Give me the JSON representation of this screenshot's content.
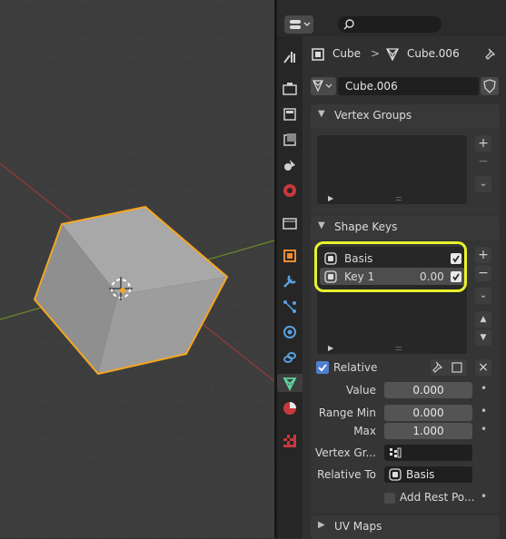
{
  "breadcrumb": {
    "object": "Cube",
    "separator": ">",
    "mesh": "Cube.006"
  },
  "mesh_name": "Cube.006",
  "panels": {
    "vertex_groups": {
      "title": "Vertex Groups",
      "add": "+",
      "remove": "−"
    },
    "shape_keys": {
      "title": "Shape Keys",
      "keys": [
        {
          "name": "Basis",
          "value": "",
          "enabled": true
        },
        {
          "name": "Key 1",
          "value": "0.00",
          "enabled": true
        }
      ],
      "relative_label": "Relative",
      "value_label": "Value",
      "value": "0.000",
      "range_min_label": "Range Min",
      "range_min": "0.000",
      "max_label": "Max",
      "max": "1.000",
      "vertex_group_label": "Vertex Gr...",
      "relative_to_label": "Relative To",
      "relative_to": "Basis",
      "add_rest_label": "Add Rest Po..."
    },
    "uv_maps": {
      "title": "UV Maps"
    }
  },
  "colors": {
    "highlight": "#e9f22d",
    "selection": "#f5a623",
    "active_tab": "#5fd3a0"
  },
  "icons": [
    "editor-type-icon",
    "search-icon",
    "tool-icon",
    "render-icon",
    "output-icon",
    "view-layer-icon",
    "scene-icon",
    "world-icon",
    "collection-icon",
    "object-icon",
    "modifier-icon",
    "particles-icon",
    "physics-icon",
    "constraints-icon",
    "data-icon",
    "material-icon",
    "texture-icon",
    "pin-icon",
    "shield-icon"
  ]
}
